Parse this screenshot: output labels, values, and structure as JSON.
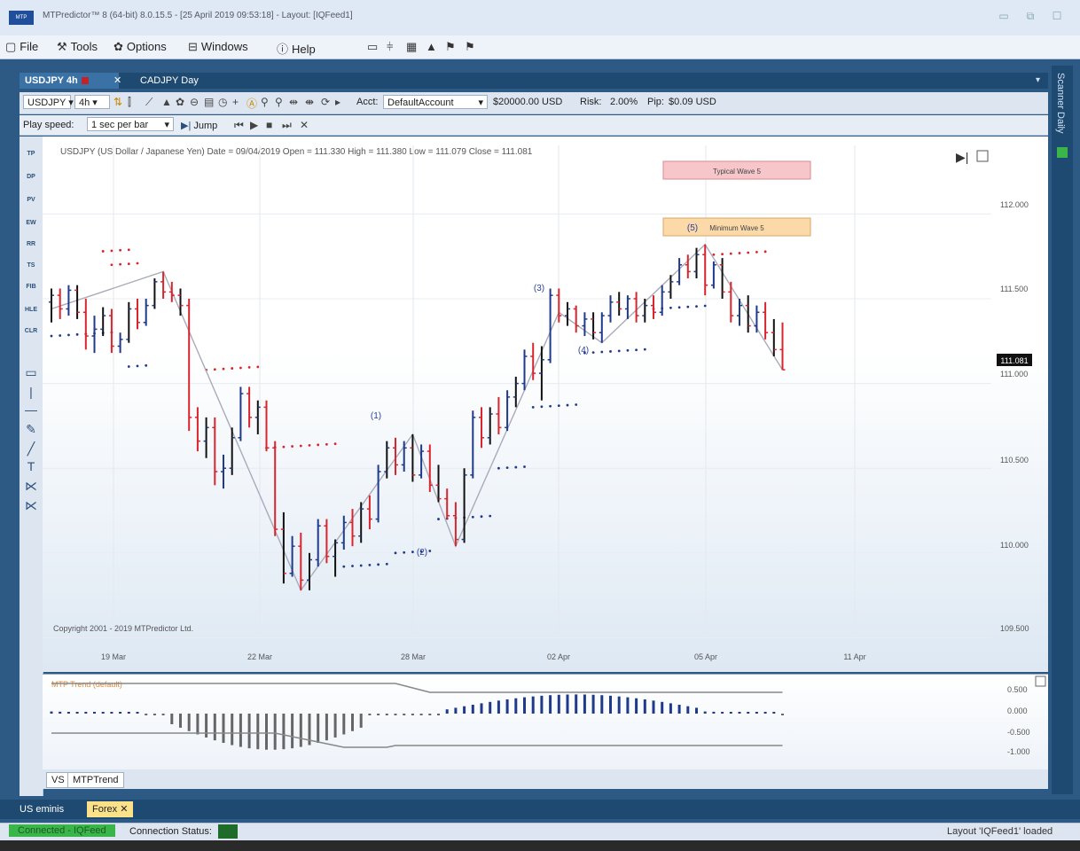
{
  "window": {
    "title": "MTPredictor™ 8 (64-bit) 8.0.15.5 - [25 April 2019 09:53:18] - Layout: [IQFeed1]"
  },
  "menu": {
    "items": [
      {
        "label": "File",
        "icon": "file-icon"
      },
      {
        "label": "Tools",
        "icon": "tools-icon"
      },
      {
        "label": "Options",
        "icon": "gear-icon"
      },
      {
        "label": "Windows",
        "icon": "windows-icon"
      },
      {
        "label": "Help",
        "icon": "help-icon"
      }
    ]
  },
  "tabs": {
    "active": "USDJPY 4h",
    "other": "CADJPY Day"
  },
  "toolbar": {
    "symbol": "USDJPY",
    "timeframe": "4h",
    "acct_label": "Acct:",
    "account": "DefaultAccount",
    "balance": "$20000.00 USD",
    "risk_label": "Risk:",
    "risk": "2.00%",
    "pip_label": "Pip:",
    "pip": "$0.09 USD"
  },
  "playbar": {
    "label": "Play speed:",
    "speed": "1 sec per bar",
    "jump": "Jump"
  },
  "lefttools": [
    "TP",
    "DP",
    "PV",
    "EW",
    "RR",
    "TS",
    "FIB",
    "HLE",
    "CLR"
  ],
  "chart": {
    "header": "USDJPY (US Dollar / Japanese Yen) Date = 09/04/2019 Open = 111.330 High = 111.380 Low = 111.079 Close = 111.081",
    "copyright": "Copyright 2001 - 2019 MTPredictor Ltd.",
    "last_price": "111.081",
    "price_labels": [
      "112.000",
      "111.500",
      "111.000",
      "110.500",
      "110.000",
      "109.500"
    ],
    "date_labels": [
      "19 Mar",
      "22 Mar",
      "28 Mar",
      "02 Apr",
      "05 Apr",
      "11 Apr"
    ],
    "wave_labels": [
      "(1)",
      "(2)",
      "(3)",
      "(4)",
      "(5)"
    ],
    "typical_wave_box": "Typical Wave 5",
    "minimum_wave_box": "Minimum Wave 5",
    "colors": {
      "up": "#1f3a8a",
      "down": "#d9252e",
      "neutral": "#111111"
    }
  },
  "indicator": {
    "title": "MTP Trend",
    "subtitle": "(default)",
    "labels": [
      "0.500",
      "0.000",
      "-0.500",
      "-1.000"
    ]
  },
  "bottom_tabs": [
    "VS",
    "MTPTrend"
  ],
  "workspace_tabs": [
    "US eminis",
    "Forex"
  ],
  "status": {
    "connected": "Connected - IQFeed",
    "connection_status": "Connection Status:",
    "layout_msg": "Layout 'IQFeed1' loaded"
  },
  "sidebar": {
    "label": "Scanner Daily"
  },
  "chart_data": {
    "type": "candlestick",
    "ylim": [
      109.45,
      112.3
    ],
    "bars": [
      [
        111.48,
        111.56,
        111.36,
        111.52
      ],
      [
        111.52,
        111.56,
        111.38,
        111.44
      ],
      [
        111.44,
        111.58,
        111.4,
        111.55
      ],
      [
        111.55,
        111.58,
        111.38,
        111.42
      ],
      [
        111.42,
        111.5,
        111.2,
        111.28
      ],
      [
        111.28,
        111.4,
        111.18,
        111.32
      ],
      [
        111.32,
        111.45,
        111.28,
        111.4
      ],
      [
        111.4,
        111.44,
        111.18,
        111.22
      ],
      [
        111.22,
        111.3,
        111.18,
        111.26
      ],
      [
        111.26,
        111.48,
        111.24,
        111.44
      ],
      [
        111.44,
        111.5,
        111.32,
        111.36
      ],
      [
        111.36,
        111.5,
        111.34,
        111.46
      ],
      [
        111.46,
        111.62,
        111.44,
        111.6
      ],
      [
        111.6,
        111.66,
        111.5,
        111.54
      ],
      [
        111.54,
        111.6,
        111.48,
        111.52
      ],
      [
        111.52,
        111.56,
        111.4,
        111.46
      ],
      [
        111.46,
        111.5,
        110.72,
        110.8
      ],
      [
        110.8,
        110.86,
        110.6,
        110.66
      ],
      [
        110.66,
        110.8,
        110.56,
        110.74
      ],
      [
        110.74,
        110.8,
        110.4,
        110.48
      ],
      [
        110.48,
        110.58,
        110.38,
        110.5
      ],
      [
        110.5,
        110.74,
        110.46,
        110.68
      ],
      [
        110.68,
        110.98,
        110.66,
        110.94
      ],
      [
        110.94,
        110.98,
        110.74,
        110.8
      ],
      [
        110.8,
        110.9,
        110.7,
        110.86
      ],
      [
        110.86,
        110.9,
        110.6,
        110.62
      ],
      [
        110.62,
        110.66,
        110.1,
        110.14
      ],
      [
        110.14,
        110.24,
        109.82,
        109.88
      ],
      [
        109.88,
        110.1,
        109.86,
        110.04
      ],
      [
        110.04,
        110.12,
        109.78,
        109.84
      ],
      [
        109.84,
        110.0,
        109.78,
        109.96
      ],
      [
        109.96,
        110.2,
        109.92,
        110.16
      ],
      [
        110.16,
        110.2,
        109.94,
        109.98
      ],
      [
        109.98,
        110.08,
        109.86,
        110.06
      ],
      [
        110.06,
        110.22,
        110.02,
        110.18
      ],
      [
        110.18,
        110.26,
        110.04,
        110.1
      ],
      [
        110.1,
        110.3,
        110.06,
        110.26
      ],
      [
        110.26,
        110.34,
        110.14,
        110.2
      ],
      [
        110.2,
        110.52,
        110.18,
        110.48
      ],
      [
        110.48,
        110.66,
        110.44,
        110.62
      ],
      [
        110.62,
        110.68,
        110.46,
        110.52
      ],
      [
        110.52,
        110.66,
        110.48,
        110.62
      ],
      [
        110.62,
        110.7,
        110.42,
        110.46
      ],
      [
        110.46,
        110.64,
        110.44,
        110.6
      ],
      [
        110.6,
        110.64,
        110.36,
        110.4
      ],
      [
        110.4,
        110.52,
        110.3,
        110.32
      ],
      [
        110.32,
        110.38,
        110.2,
        110.22
      ],
      [
        110.22,
        110.3,
        110.04,
        110.08
      ],
      [
        110.08,
        110.5,
        110.06,
        110.46
      ],
      [
        110.46,
        110.84,
        110.44,
        110.8
      ],
      [
        110.8,
        110.86,
        110.62,
        110.68
      ],
      [
        110.68,
        110.86,
        110.64,
        110.82
      ],
      [
        110.82,
        110.92,
        110.7,
        110.74
      ],
      [
        110.74,
        110.96,
        110.72,
        110.92
      ],
      [
        110.92,
        111.04,
        110.86,
        111.0
      ],
      [
        111.0,
        111.2,
        110.96,
        111.16
      ],
      [
        111.16,
        111.24,
        111.02,
        111.06
      ],
      [
        111.06,
        111.22,
        110.9,
        111.14
      ],
      [
        111.14,
        111.56,
        111.12,
        111.52
      ],
      [
        111.52,
        111.56,
        111.36,
        111.4
      ],
      [
        111.4,
        111.48,
        111.34,
        111.44
      ],
      [
        111.44,
        111.46,
        111.3,
        111.34
      ],
      [
        111.34,
        111.42,
        111.28,
        111.38
      ],
      [
        111.38,
        111.42,
        111.26,
        111.3
      ],
      [
        111.3,
        111.42,
        111.24,
        111.4
      ],
      [
        111.4,
        111.52,
        111.36,
        111.48
      ],
      [
        111.48,
        111.54,
        111.4,
        111.44
      ],
      [
        111.44,
        111.52,
        111.38,
        111.5
      ],
      [
        111.5,
        111.54,
        111.36,
        111.4
      ],
      [
        111.4,
        111.5,
        111.36,
        111.46
      ],
      [
        111.46,
        111.52,
        111.38,
        111.42
      ],
      [
        111.42,
        111.58,
        111.4,
        111.54
      ],
      [
        111.54,
        111.64,
        111.5,
        111.6
      ],
      [
        111.6,
        111.74,
        111.58,
        111.7
      ],
      [
        111.7,
        111.76,
        111.62,
        111.66
      ],
      [
        111.66,
        111.8,
        111.62,
        111.76
      ],
      [
        111.76,
        111.82,
        111.52,
        111.58
      ],
      [
        111.58,
        111.72,
        111.56,
        111.7
      ],
      [
        111.7,
        111.74,
        111.5,
        111.54
      ],
      [
        111.54,
        111.6,
        111.36,
        111.4
      ],
      [
        111.4,
        111.5,
        111.34,
        111.46
      ],
      [
        111.46,
        111.52,
        111.3,
        111.34
      ],
      [
        111.34,
        111.46,
        111.3,
        111.42
      ],
      [
        111.42,
        111.48,
        111.26,
        111.3
      ],
      [
        111.3,
        111.38,
        111.16,
        111.2
      ],
      [
        111.2,
        111.36,
        111.08,
        111.081
      ]
    ]
  }
}
